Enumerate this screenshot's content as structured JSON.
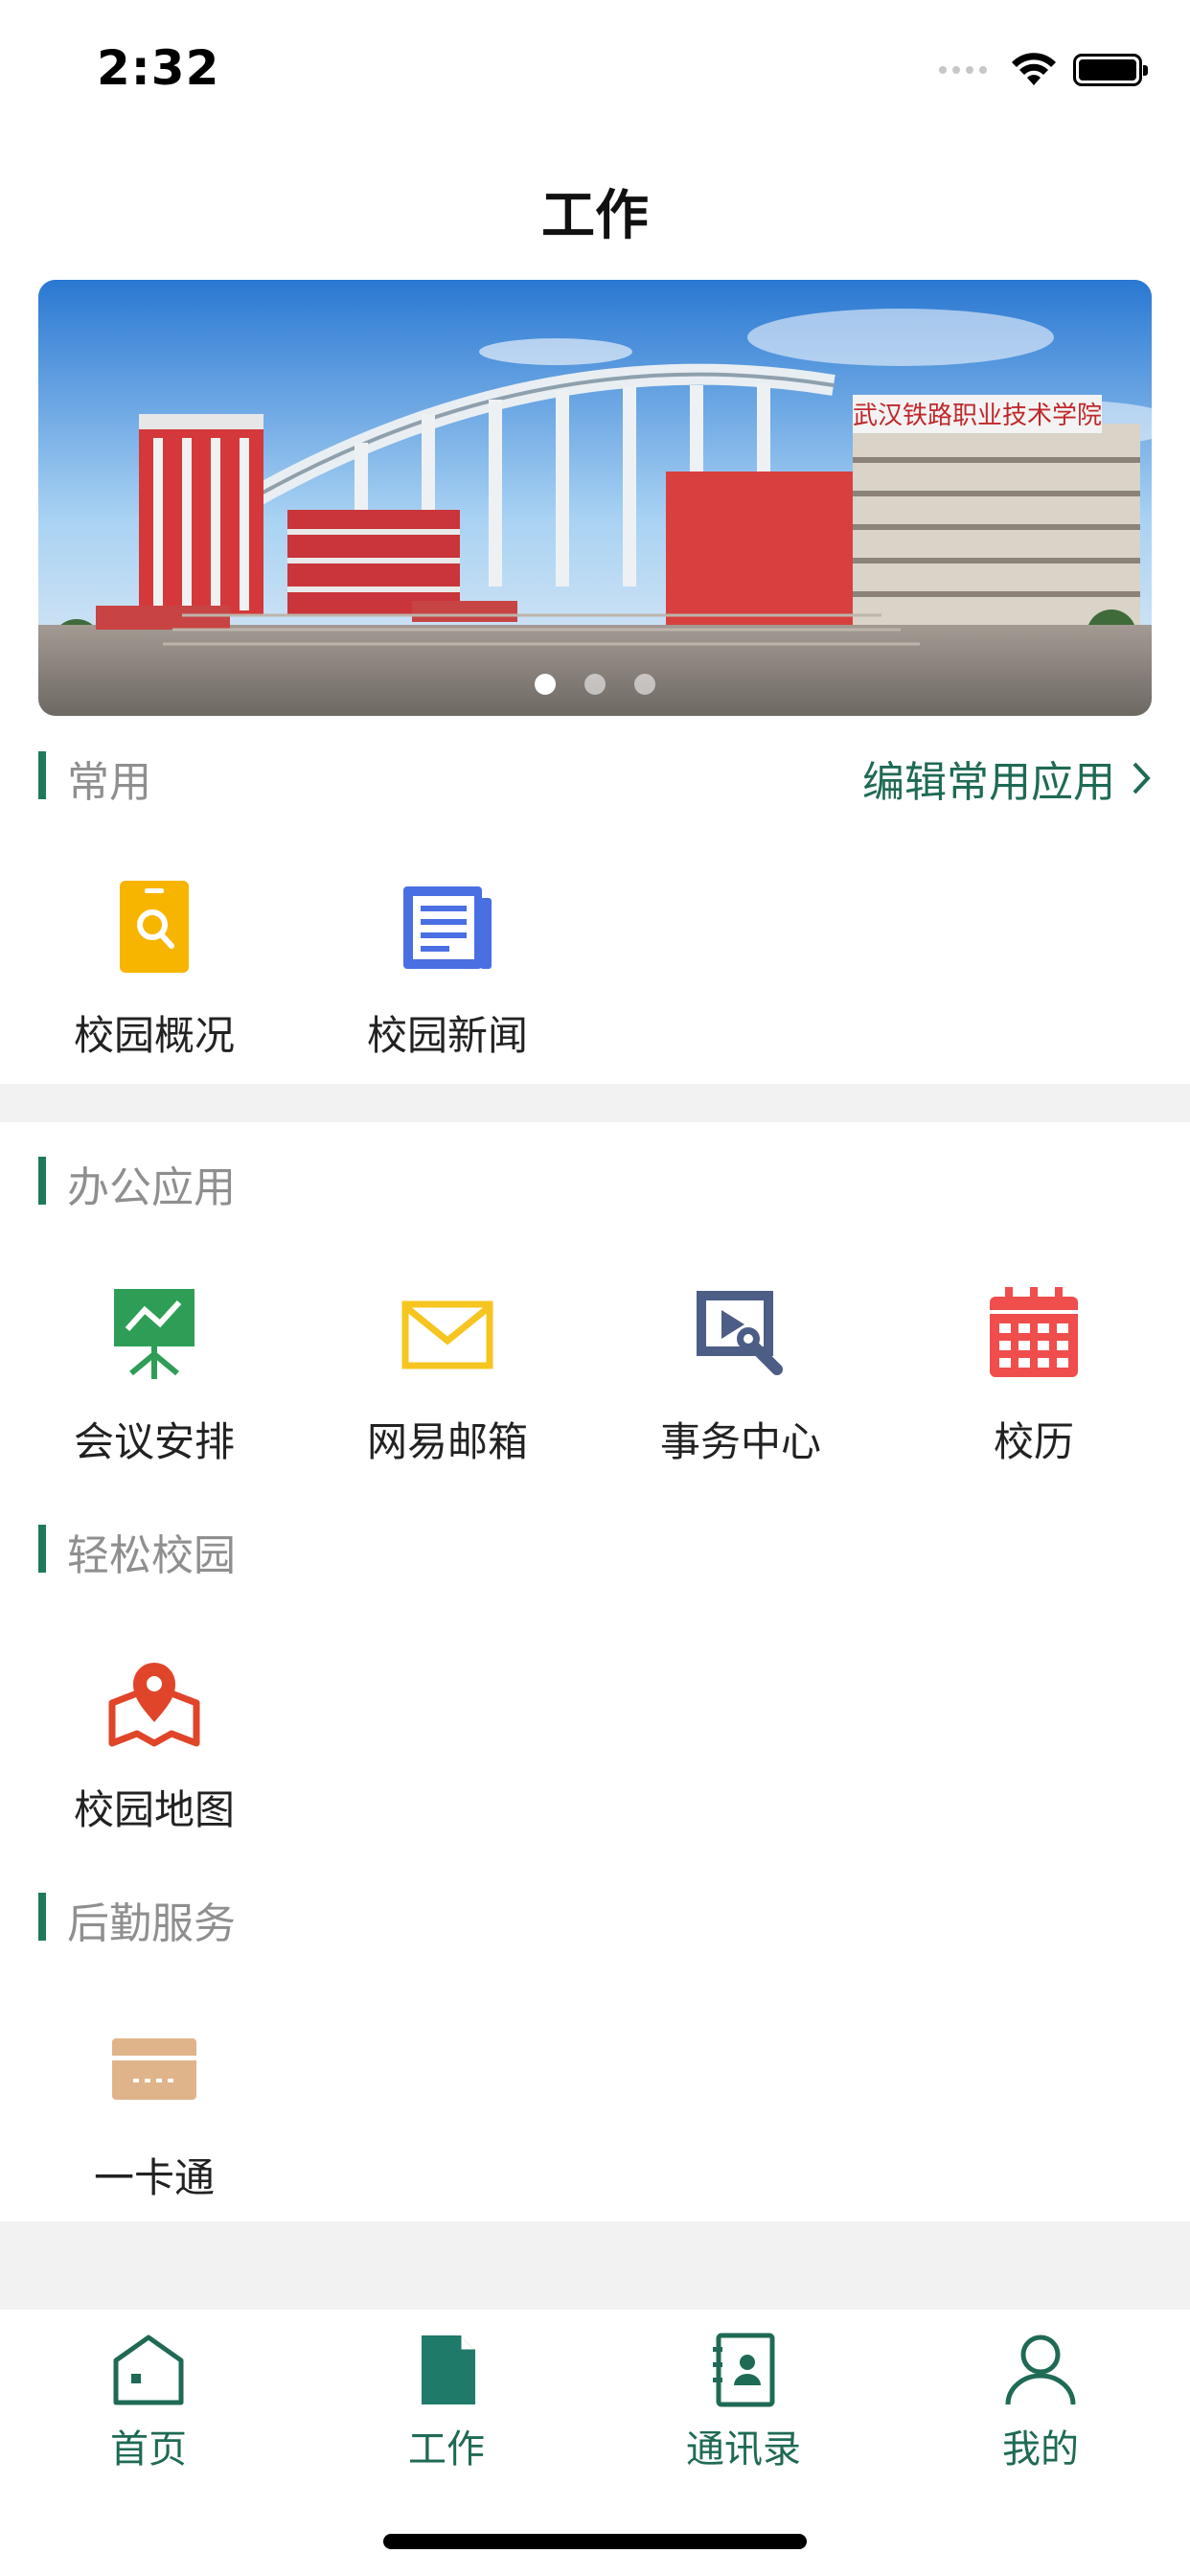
{
  "status_bar": {
    "time": "2:32"
  },
  "header": {
    "title": "工作"
  },
  "banner": {
    "sign_text": "武汉铁路职业技术学院",
    "page_count": 3,
    "active_page": 1
  },
  "sections": {
    "common": {
      "title": "常用",
      "edit_link": "编辑常用应用",
      "apps": [
        {
          "label": "校园概况",
          "icon": "campus-overview-icon",
          "color": "#f7b500"
        },
        {
          "label": "校园新闻",
          "icon": "campus-news-icon",
          "color": "#4a6fe3"
        }
      ]
    },
    "office": {
      "title": "办公应用",
      "apps": [
        {
          "label": "会议安排",
          "icon": "meeting-icon",
          "color": "#2e9e57"
        },
        {
          "label": "网易邮箱",
          "icon": "mail-icon",
          "color": "#f7c520"
        },
        {
          "label": "事务中心",
          "icon": "affairs-icon",
          "color": "#4c5d86"
        },
        {
          "label": "校历",
          "icon": "calendar-icon",
          "color": "#f04d4d"
        }
      ]
    },
    "campus": {
      "title": "轻松校园",
      "apps": [
        {
          "label": "校园地图",
          "icon": "map-icon",
          "color": "#e0452a"
        }
      ]
    },
    "logistics": {
      "title": "后勤服务",
      "apps": [
        {
          "label": "一卡通",
          "icon": "card-icon",
          "color": "#e0b48a"
        }
      ]
    }
  },
  "tabbar": {
    "items": [
      {
        "label": "首页",
        "icon": "home-icon"
      },
      {
        "label": "工作",
        "icon": "work-icon",
        "active": true
      },
      {
        "label": "通讯录",
        "icon": "contacts-icon"
      },
      {
        "label": "我的",
        "icon": "profile-icon"
      }
    ]
  }
}
